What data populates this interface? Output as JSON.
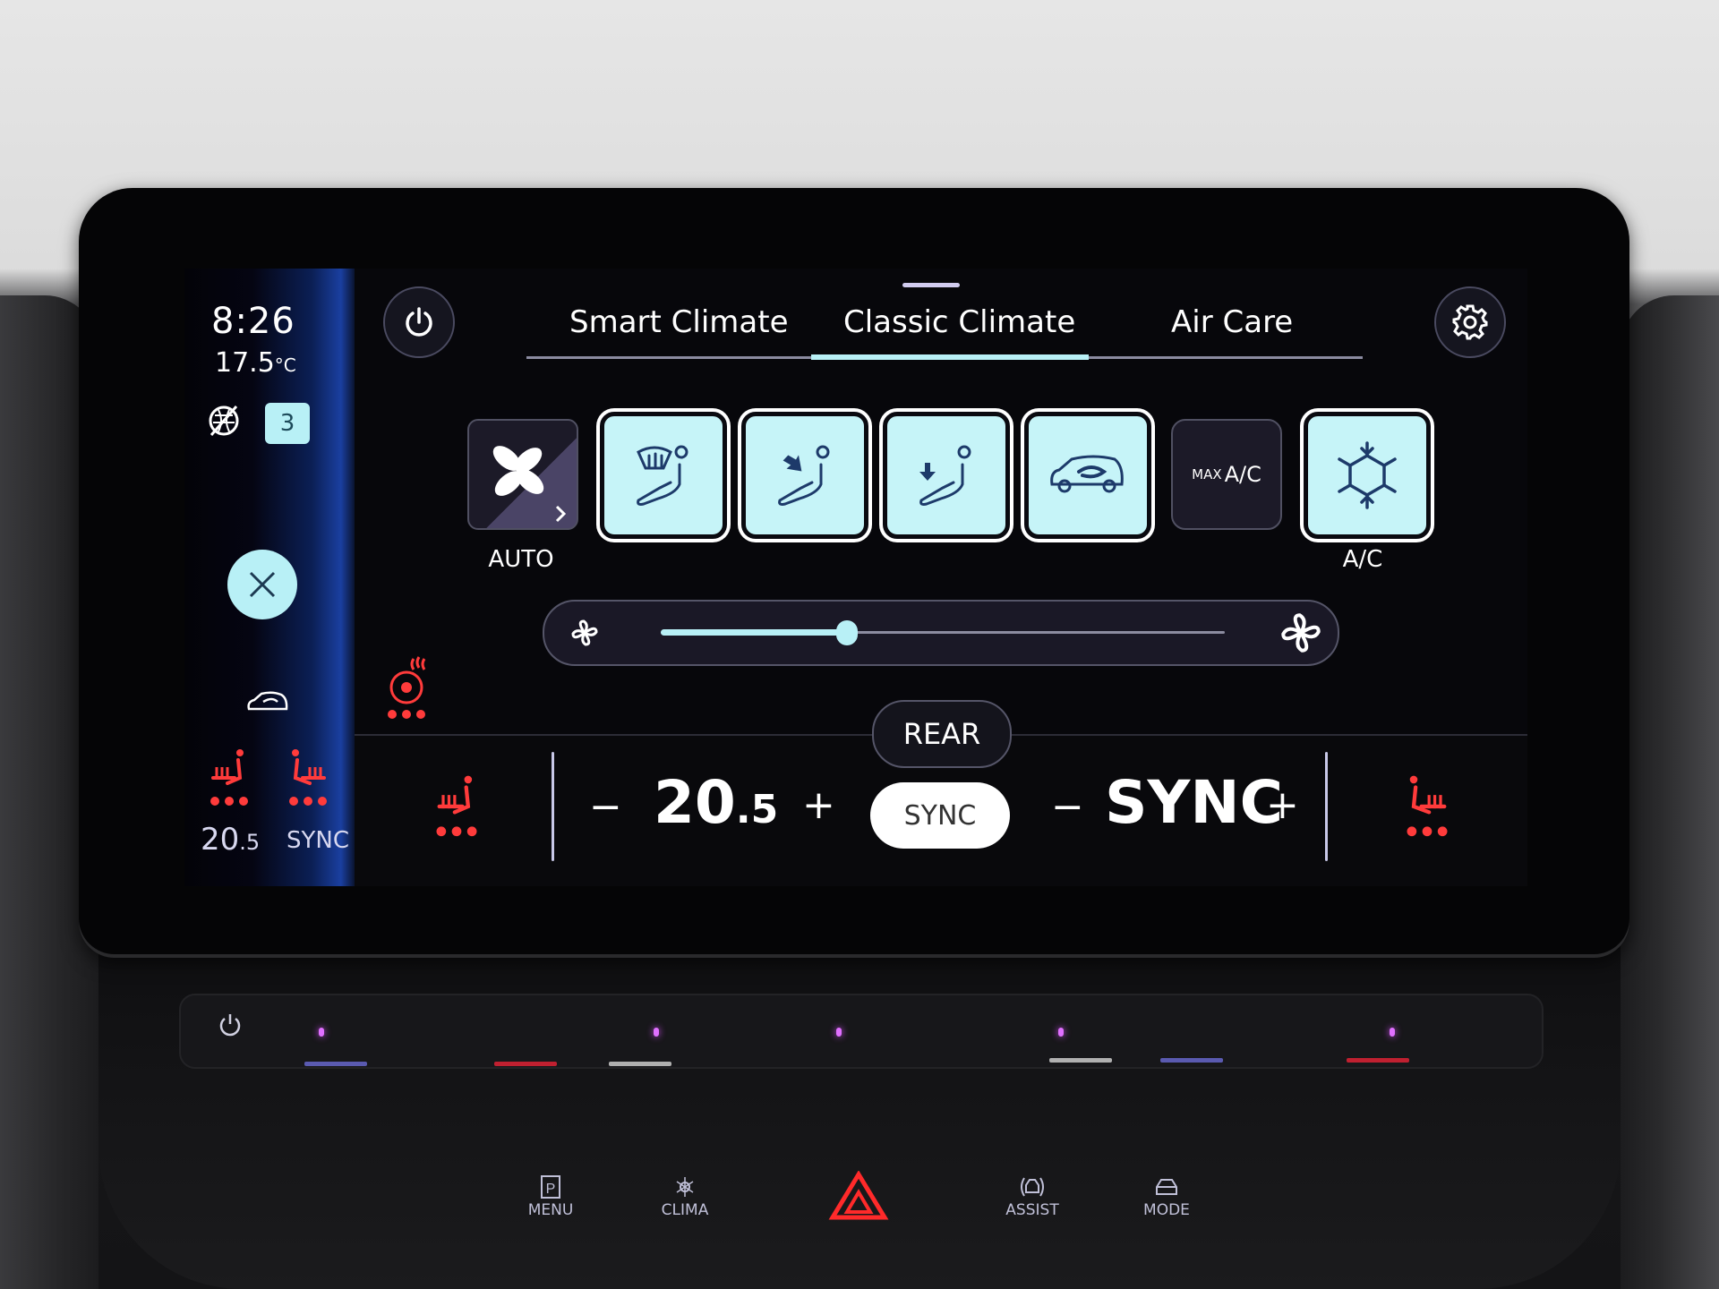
{
  "sidebar": {
    "time": "8:26",
    "outside_temp": "17.5",
    "outside_temp_unit": "°C",
    "recirc_icon": "recirculation-off-icon",
    "badge_value": "3",
    "close_icon": "close-icon",
    "car_icon": "car-recirculation-icon",
    "left_seat": {
      "value_main": "20",
      "value_decimal": ".5",
      "heat_level": 3
    },
    "right_seat": {
      "value": "SYNC",
      "heat_level": 3
    }
  },
  "header": {
    "power_icon": "power-icon",
    "settings_icon": "gear-icon",
    "tabs": [
      {
        "label": "Smart Climate",
        "active": false
      },
      {
        "label": "Classic Climate",
        "active": true
      },
      {
        "label": "Air Care",
        "active": false
      }
    ]
  },
  "tiles": [
    {
      "id": "auto",
      "label": "AUTO",
      "icon": "fan-icon",
      "active": false
    },
    {
      "id": "defrost",
      "label": "",
      "icon": "windshield-defrost-icon",
      "active": true
    },
    {
      "id": "vent-upper",
      "label": "",
      "icon": "airflow-upper-body-icon",
      "active": true
    },
    {
      "id": "vent-feet",
      "label": "",
      "icon": "airflow-feet-icon",
      "active": true
    },
    {
      "id": "recirc",
      "label": "",
      "icon": "car-recirculation-icon",
      "active": true
    },
    {
      "id": "max-ac",
      "label_small": "MAX",
      "label_big": "A/C",
      "active": false
    },
    {
      "id": "ac",
      "label": "A/C",
      "icon": "snowflake-icon",
      "active": true
    }
  ],
  "fan": {
    "min_icon": "fan-low-icon",
    "max_icon": "fan-high-icon",
    "level_fraction": 0.33
  },
  "steering_heat": {
    "icon": "heated-steering-wheel-icon",
    "level": 3
  },
  "climate_bar": {
    "rear_label": "REAR",
    "sync_label": "SYNC",
    "driver_temp_main": "20",
    "driver_temp_decimal": ".5",
    "passenger_temp": "SYNC",
    "minus": "−",
    "plus": "+",
    "driver_seat_heat_level": 3,
    "passenger_seat_heat_level": 3
  },
  "hardware": {
    "buttons": [
      {
        "label": "MENU",
        "icon": "parking-p-icon"
      },
      {
        "label": "CLIMA",
        "icon": "snowflake-sun-icon"
      },
      {
        "label": "",
        "icon": "hazard-warning-icon"
      },
      {
        "label": "ASSIST",
        "icon": "assist-car-icon"
      },
      {
        "label": "MODE",
        "icon": "drive-mode-car-icon"
      }
    ],
    "colors": {
      "accent": "#b8f0f6",
      "heat": "#ff3b3b",
      "hazard": "#ff2a2a",
      "led": "#e070ff"
    }
  }
}
